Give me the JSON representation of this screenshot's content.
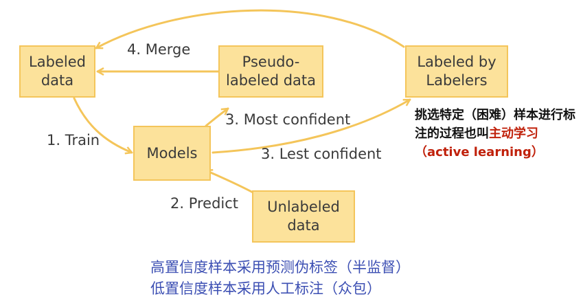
{
  "boxes": {
    "labeled_data": "Labeled\ndata",
    "pseudo_labeled_data": "Pseudo-\nlabeled data",
    "labeled_by_labelers": "Labeled by\nLabelers",
    "models": "Models",
    "unlabeled_data": "Unlabeled\ndata"
  },
  "edges": {
    "train": "1. Train",
    "predict": "2. Predict",
    "most_confident": "3. Most confident",
    "lest_confident": "3. Lest confident",
    "merge": "4. Merge"
  },
  "note": {
    "text": "挑选特定（困难）样本进行标注的过程也叫",
    "highlight": "主动学习（active learning）"
  },
  "summary": [
    "高置信度样本采用预测伪标签（半监督）",
    "低置信度样本采用人工标注（众包）"
  ],
  "colors": {
    "box_fill": "#fce29b",
    "box_border": "#f4c55a",
    "arrow": "#f4c55a",
    "note_highlight": "#c0210b",
    "summary_text": "#3c4fb3"
  }
}
